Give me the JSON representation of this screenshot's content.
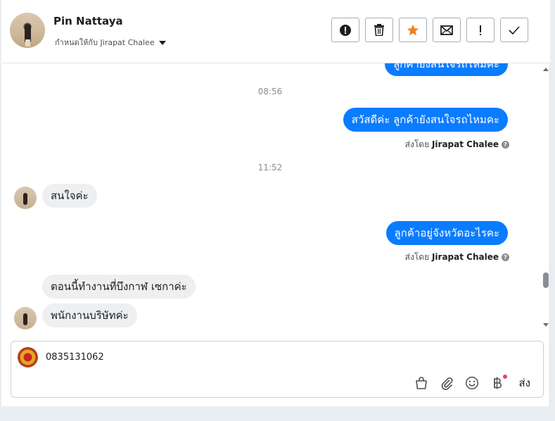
{
  "header": {
    "contact_name": "Pin Nattaya",
    "assigned_to": "กำหนดให้กับ Jirapat Chalee",
    "actions": [
      {
        "icon": "alert-circle-icon",
        "glyph": "!"
      },
      {
        "icon": "trash-icon",
        "glyph": "🗑"
      },
      {
        "icon": "star-icon",
        "glyph": "★"
      },
      {
        "icon": "envelope-icon",
        "glyph": "✉"
      },
      {
        "icon": "exclamation-icon",
        "glyph": "!"
      },
      {
        "icon": "check-icon",
        "glyph": "✓"
      }
    ]
  },
  "chat": {
    "messages": [
      {
        "type": "time",
        "text": "08:56"
      },
      {
        "type": "out",
        "text": "สวัสดีค่ะ ลูกค้ายังสนใจรถไหมคะ",
        "sent_by_prefix": "ส่งโดย",
        "sent_by_name": "Jirapat Chalee"
      },
      {
        "type": "time",
        "text": "11:52"
      },
      {
        "type": "in",
        "text": "สนใจค่ะ"
      },
      {
        "type": "out",
        "text": "ลูกค้าอยู่จังหวัดอะไรคะ",
        "sent_by_prefix": "ส่งโดย",
        "sent_by_name": "Jirapat Chalee"
      },
      {
        "type": "in",
        "text": "ตอนนี้ทำงานที่บึงกาฬ เซกาค่ะ"
      },
      {
        "type": "in",
        "text": "พนักงานบริษัทค่ะ"
      }
    ],
    "top_partial_text": "ลูกค้ายังสนใจรถไหมคะ"
  },
  "composer": {
    "text": "0835131062",
    "tools": [
      "bag-icon",
      "paperclip-icon",
      "emoji-icon",
      "baht-icon"
    ],
    "send_label": "ส่ง"
  },
  "colors": {
    "outgoing_bubble": "#0a7cff",
    "incoming_bubble": "#eeeff1",
    "star": "#f0821d",
    "notification_dot": "#e8445a"
  }
}
